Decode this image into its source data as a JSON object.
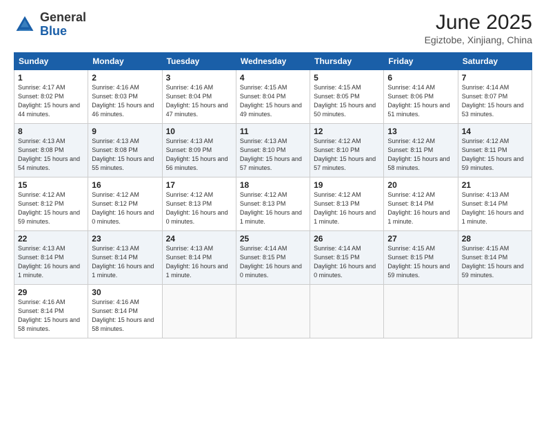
{
  "logo": {
    "general": "General",
    "blue": "Blue"
  },
  "title": "June 2025",
  "subtitle": "Egiztobe, Xinjiang, China",
  "days_of_week": [
    "Sunday",
    "Monday",
    "Tuesday",
    "Wednesday",
    "Thursday",
    "Friday",
    "Saturday"
  ],
  "weeks": [
    [
      {
        "day": "1",
        "sunrise": "4:17 AM",
        "sunset": "8:02 PM",
        "daylight": "15 hours and 44 minutes."
      },
      {
        "day": "2",
        "sunrise": "4:16 AM",
        "sunset": "8:03 PM",
        "daylight": "15 hours and 46 minutes."
      },
      {
        "day": "3",
        "sunrise": "4:16 AM",
        "sunset": "8:04 PM",
        "daylight": "15 hours and 47 minutes."
      },
      {
        "day": "4",
        "sunrise": "4:15 AM",
        "sunset": "8:04 PM",
        "daylight": "15 hours and 49 minutes."
      },
      {
        "day": "5",
        "sunrise": "4:15 AM",
        "sunset": "8:05 PM",
        "daylight": "15 hours and 50 minutes."
      },
      {
        "day": "6",
        "sunrise": "4:14 AM",
        "sunset": "8:06 PM",
        "daylight": "15 hours and 51 minutes."
      },
      {
        "day": "7",
        "sunrise": "4:14 AM",
        "sunset": "8:07 PM",
        "daylight": "15 hours and 53 minutes."
      }
    ],
    [
      {
        "day": "8",
        "sunrise": "4:13 AM",
        "sunset": "8:08 PM",
        "daylight": "15 hours and 54 minutes."
      },
      {
        "day": "9",
        "sunrise": "4:13 AM",
        "sunset": "8:08 PM",
        "daylight": "15 hours and 55 minutes."
      },
      {
        "day": "10",
        "sunrise": "4:13 AM",
        "sunset": "8:09 PM",
        "daylight": "15 hours and 56 minutes."
      },
      {
        "day": "11",
        "sunrise": "4:13 AM",
        "sunset": "8:10 PM",
        "daylight": "15 hours and 57 minutes."
      },
      {
        "day": "12",
        "sunrise": "4:12 AM",
        "sunset": "8:10 PM",
        "daylight": "15 hours and 57 minutes."
      },
      {
        "day": "13",
        "sunrise": "4:12 AM",
        "sunset": "8:11 PM",
        "daylight": "15 hours and 58 minutes."
      },
      {
        "day": "14",
        "sunrise": "4:12 AM",
        "sunset": "8:11 PM",
        "daylight": "15 hours and 59 minutes."
      }
    ],
    [
      {
        "day": "15",
        "sunrise": "4:12 AM",
        "sunset": "8:12 PM",
        "daylight": "15 hours and 59 minutes."
      },
      {
        "day": "16",
        "sunrise": "4:12 AM",
        "sunset": "8:12 PM",
        "daylight": "16 hours and 0 minutes."
      },
      {
        "day": "17",
        "sunrise": "4:12 AM",
        "sunset": "8:13 PM",
        "daylight": "16 hours and 0 minutes."
      },
      {
        "day": "18",
        "sunrise": "4:12 AM",
        "sunset": "8:13 PM",
        "daylight": "16 hours and 1 minute."
      },
      {
        "day": "19",
        "sunrise": "4:12 AM",
        "sunset": "8:13 PM",
        "daylight": "16 hours and 1 minute."
      },
      {
        "day": "20",
        "sunrise": "4:12 AM",
        "sunset": "8:14 PM",
        "daylight": "16 hours and 1 minute."
      },
      {
        "day": "21",
        "sunrise": "4:13 AM",
        "sunset": "8:14 PM",
        "daylight": "16 hours and 1 minute."
      }
    ],
    [
      {
        "day": "22",
        "sunrise": "4:13 AM",
        "sunset": "8:14 PM",
        "daylight": "16 hours and 1 minute."
      },
      {
        "day": "23",
        "sunrise": "4:13 AM",
        "sunset": "8:14 PM",
        "daylight": "16 hours and 1 minute."
      },
      {
        "day": "24",
        "sunrise": "4:13 AM",
        "sunset": "8:14 PM",
        "daylight": "16 hours and 1 minute."
      },
      {
        "day": "25",
        "sunrise": "4:14 AM",
        "sunset": "8:15 PM",
        "daylight": "16 hours and 0 minutes."
      },
      {
        "day": "26",
        "sunrise": "4:14 AM",
        "sunset": "8:15 PM",
        "daylight": "16 hours and 0 minutes."
      },
      {
        "day": "27",
        "sunrise": "4:15 AM",
        "sunset": "8:15 PM",
        "daylight": "15 hours and 59 minutes."
      },
      {
        "day": "28",
        "sunrise": "4:15 AM",
        "sunset": "8:14 PM",
        "daylight": "15 hours and 59 minutes."
      }
    ],
    [
      {
        "day": "29",
        "sunrise": "4:16 AM",
        "sunset": "8:14 PM",
        "daylight": "15 hours and 58 minutes."
      },
      {
        "day": "30",
        "sunrise": "4:16 AM",
        "sunset": "8:14 PM",
        "daylight": "15 hours and 58 minutes."
      },
      null,
      null,
      null,
      null,
      null
    ]
  ]
}
